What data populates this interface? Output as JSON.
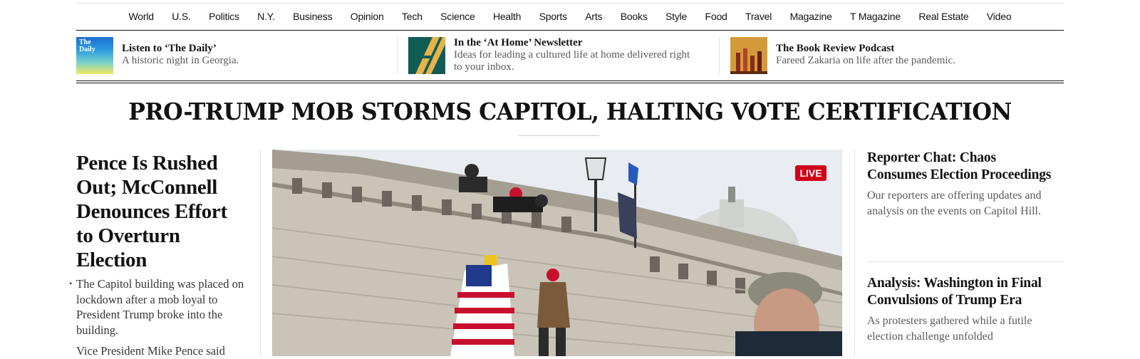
{
  "nav": {
    "items": [
      "World",
      "U.S.",
      "Politics",
      "N.Y.",
      "Business",
      "Opinion",
      "Tech",
      "Science",
      "Health",
      "Sports",
      "Arts",
      "Books",
      "Style",
      "Food",
      "Travel",
      "Magazine",
      "T Magazine",
      "Real Estate",
      "Video"
    ]
  },
  "promos": [
    {
      "thumb_label": "The Daily",
      "title": "Listen to ‘The Daily’",
      "subtitle": "A historic night in Georgia."
    },
    {
      "title": "In the ‘At Home’ Newsletter",
      "subtitle": "Ideas for leading a cultured life at home delivered right to your inbox."
    },
    {
      "title": "The Book Review Podcast",
      "subtitle": "Fareed Zakaria on life after the pandemic."
    }
  ],
  "banner": "PRO-TRUMP MOB STORMS CAPITOL, HALTING VOTE CERTIFICATION",
  "lead": {
    "headline": "Pence Is Rushed Out; McConnell Denounces Effort to Overturn Election",
    "summary": "The Capitol building was placed on lockdown after a mob loyal to President Trump broke into the building.",
    "summary_2": "Vice President Mike Pence said"
  },
  "photo": {
    "live_label": "LIVE"
  },
  "right": [
    {
      "headline": "Reporter Chat: Chaos Consumes Election Proceedings",
      "summary": "Our reporters are offering updates and analysis on the events on Capitol Hill."
    },
    {
      "headline": "Analysis: Washington in Final Convulsions of Trump Era",
      "summary": "As protesters gathered while a futile election challenge unfolded"
    }
  ],
  "colors": {
    "live_red": "#d0021b",
    "text": "#121212",
    "summary_gray": "#5a5a5a",
    "rule_gray": "#e2e2e2"
  }
}
